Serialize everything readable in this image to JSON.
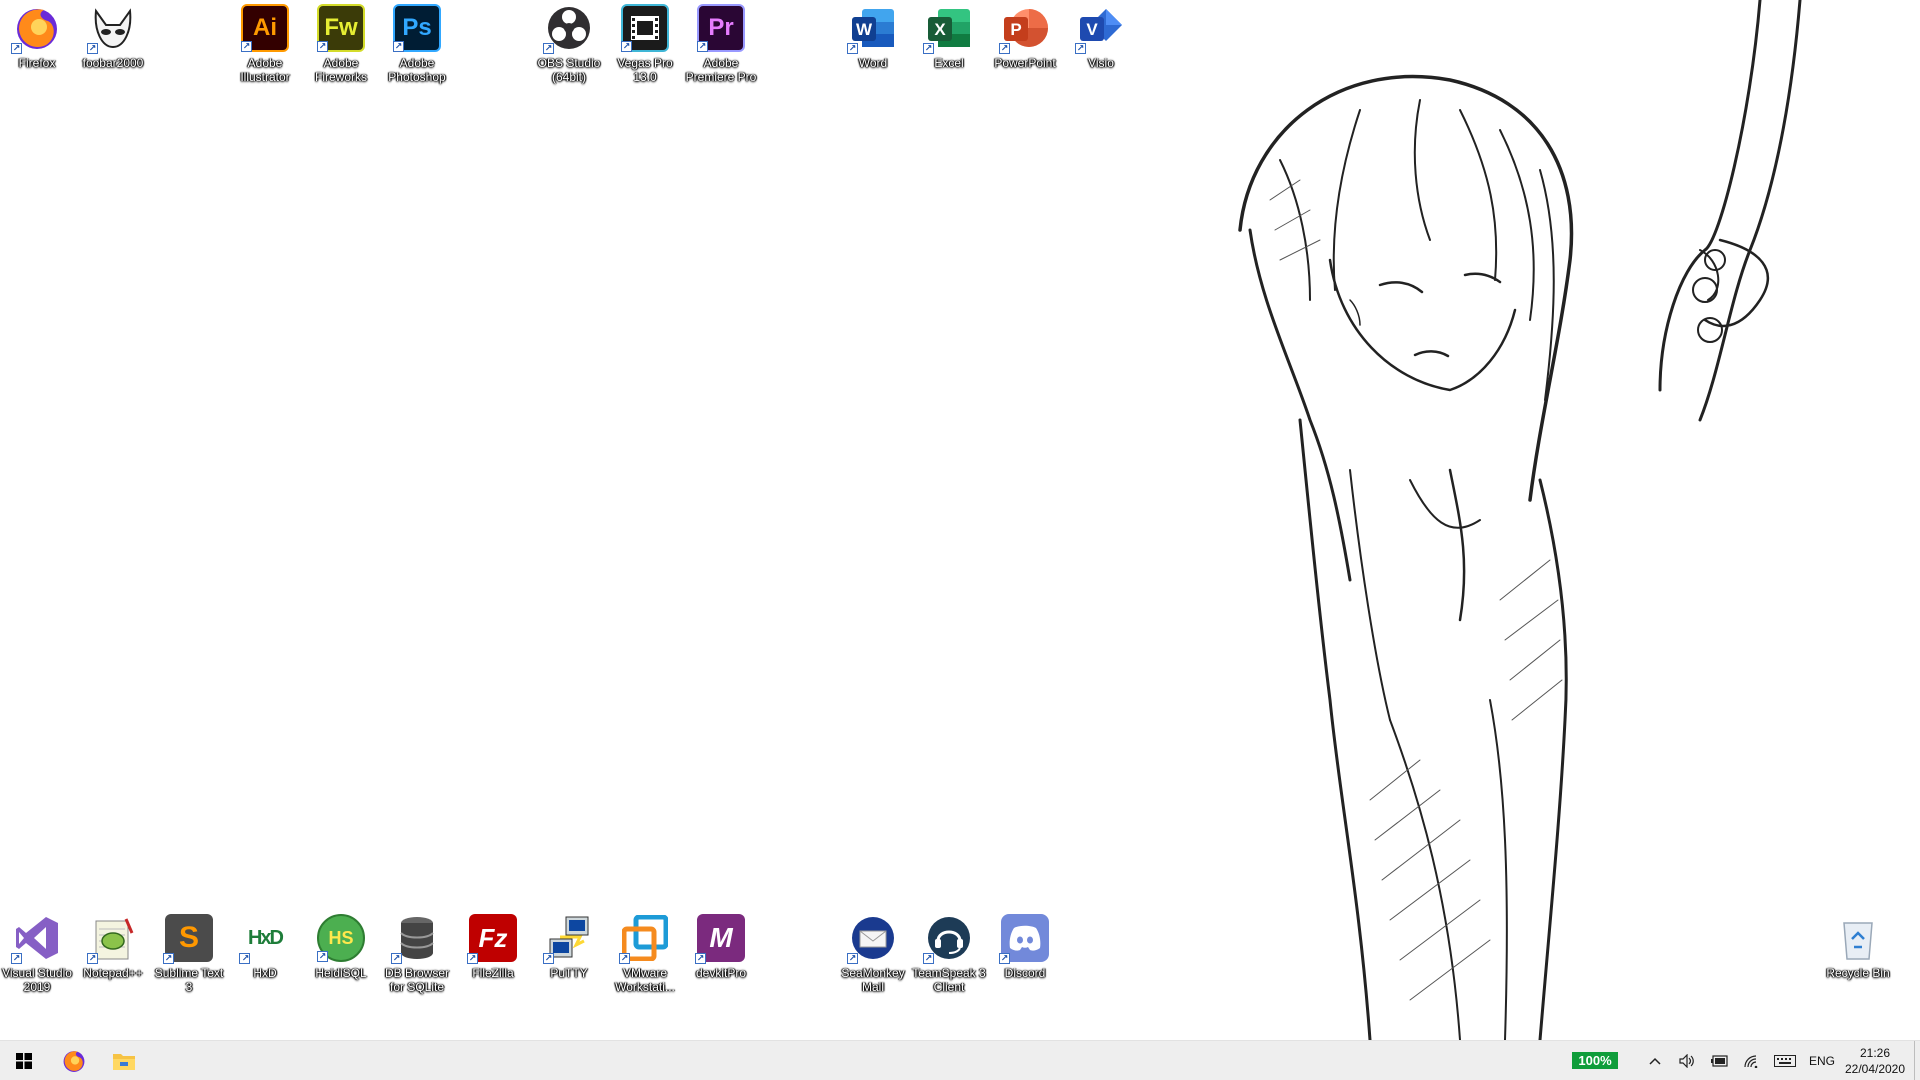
{
  "desktop": {
    "top_icons": [
      {
        "id": "firefox",
        "label": "Firefox",
        "icon": "firefox-icon"
      },
      {
        "id": "foobar2000",
        "label": "foobar2000",
        "icon": "foobar-alien-icon"
      },
      {
        "id": "illustrator",
        "label": "Adobe Illustrator",
        "icon": "illustrator-icon",
        "glyph": "Ai"
      },
      {
        "id": "fireworks",
        "label": "Adobe Fireworks",
        "icon": "fireworks-icon",
        "glyph": "Fw"
      },
      {
        "id": "photoshop",
        "label": "Adobe Photoshop",
        "icon": "photoshop-icon",
        "glyph": "Ps"
      },
      {
        "id": "obs",
        "label": "OBS Studio (64bit)",
        "icon": "obs-icon"
      },
      {
        "id": "vegas",
        "label": "Vegas Pro 13.0",
        "icon": "vegas-film-icon"
      },
      {
        "id": "premiere",
        "label": "Adobe Premiere Pro",
        "icon": "premiere-icon",
        "glyph": "Pr"
      },
      {
        "id": "word",
        "label": "Word",
        "icon": "word-icon",
        "glyph": "W"
      },
      {
        "id": "excel",
        "label": "Excel",
        "icon": "excel-icon",
        "glyph": "X"
      },
      {
        "id": "powerpoint",
        "label": "PowerPoint",
        "icon": "powerpoint-icon",
        "glyph": "P"
      },
      {
        "id": "visio",
        "label": "Visio",
        "icon": "visio-icon",
        "glyph": "V"
      }
    ],
    "bottom_icons": [
      {
        "id": "visualstudio",
        "label": "Visual Studio 2019",
        "icon": "visual-studio-icon"
      },
      {
        "id": "notepadpp",
        "label": "Notepad++",
        "icon": "notepad-plus-plus-icon"
      },
      {
        "id": "sublime",
        "label": "Sublime Text 3",
        "icon": "sublime-text-icon",
        "glyph": "S"
      },
      {
        "id": "hxd",
        "label": "HxD",
        "icon": "hxd-icon",
        "glyph": "HxD"
      },
      {
        "id": "heidisql",
        "label": "HeidiSQL",
        "icon": "heidisql-icon",
        "glyph": "HS"
      },
      {
        "id": "dbbrowser",
        "label": "DB Browser for SQLite",
        "icon": "database-icon"
      },
      {
        "id": "filezilla",
        "label": "FileZilla",
        "icon": "filezilla-icon",
        "glyph": "Fz"
      },
      {
        "id": "putty",
        "label": "PuTTY",
        "icon": "putty-icon"
      },
      {
        "id": "vmware",
        "label": "VMware Workstati...",
        "icon": "vmware-icon"
      },
      {
        "id": "devkitpro",
        "label": "devkitPro",
        "icon": "devkitpro-icon",
        "glyph": "M"
      },
      {
        "id": "seamonkey",
        "label": "SeaMonkey Mail",
        "icon": "seamonkey-mail-icon"
      },
      {
        "id": "teamspeak",
        "label": "TeamSpeak 3 Client",
        "icon": "teamspeak-icon"
      },
      {
        "id": "discord",
        "label": "Discord",
        "icon": "discord-icon"
      }
    ],
    "recycle_bin": {
      "label": "Recycle Bin",
      "icon": "recycle-bin-icon"
    }
  },
  "taskbar": {
    "pinned": [
      {
        "id": "start",
        "icon": "windows-start-icon"
      },
      {
        "id": "firefox",
        "icon": "firefox-icon"
      },
      {
        "id": "explorer",
        "icon": "file-explorer-icon"
      }
    ],
    "tray": {
      "battery_percent": "100%",
      "battery_level": 1.0,
      "language": "ENG",
      "icons": [
        "chevron-up-icon",
        "volume-icon",
        "battery-icon",
        "network-icon",
        "keyboard-icon"
      ]
    },
    "clock": {
      "time": "21:26",
      "date": "22/04/2020"
    }
  },
  "colors": {
    "taskbar_bg": "#eeeeee",
    "battery_green": "#0f9d3a",
    "illustrator": "#ff9a00",
    "fireworks": "#d4dc2a",
    "photoshop": "#31a8ff",
    "premiere": "#9999ff",
    "word": "#2b579a",
    "excel": "#217346",
    "powerpoint": "#d24726",
    "visio": "#3955a3"
  }
}
